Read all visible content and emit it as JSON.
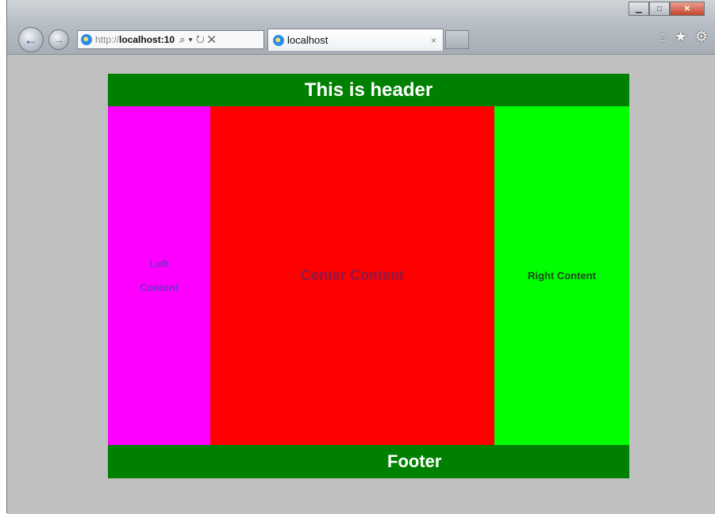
{
  "browser": {
    "address_bar": {
      "url_protocol": "http://",
      "url_host": "localhost:10"
    },
    "tab": {
      "title": "localhost",
      "close_glyph": "×"
    },
    "toolbar": {
      "home_icon": "⌂",
      "favorites_icon": "★",
      "tools_icon": "⚙"
    }
  },
  "page": {
    "header": "This is header",
    "left_line1": "Left",
    "left_line2": "Content",
    "center": "Center Content",
    "right": "Right Content",
    "footer": "Footer"
  },
  "colors": {
    "header_footer": "#008000",
    "left": "#ff00ff",
    "center": "#ff0000",
    "right": "#00ff00",
    "viewport_bg": "#c0c0c0"
  }
}
